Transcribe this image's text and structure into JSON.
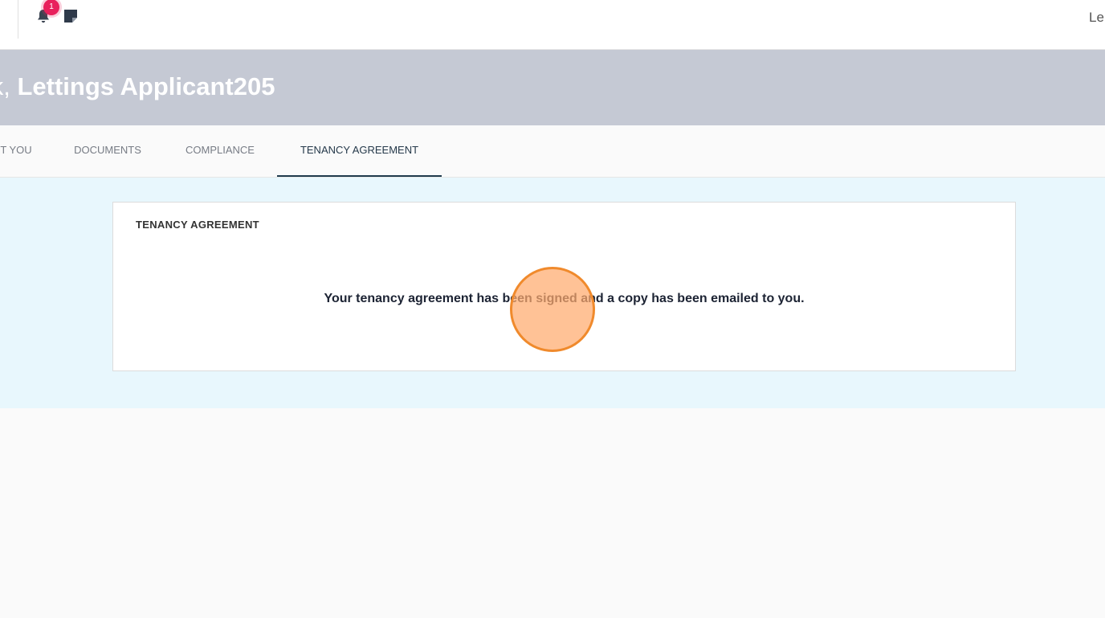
{
  "topbar": {
    "notification_count": "1",
    "user_name_partial": "Le"
  },
  "banner": {
    "greeting_prefix": "ack,",
    "user_name": "Lettings Applicant205"
  },
  "tabs": [
    {
      "label": "T YOU",
      "active": false
    },
    {
      "label": "DOCUMENTS",
      "active": false
    },
    {
      "label": "COMPLIANCE",
      "active": false
    },
    {
      "label": "TENANCY AGREEMENT",
      "active": true
    }
  ],
  "card": {
    "title": "TENANCY AGREEMENT",
    "message": "Your tenancy agreement has been signed and a copy has been emailed to you."
  },
  "colors": {
    "banner": "#c5c9d4",
    "content_bg": "#e8f7fd",
    "badge": "#e8205c",
    "active_tab": "#1f3b4d",
    "click_marker": "#f08a2c"
  },
  "icons": [
    "bell-icon",
    "sticky-note-icon"
  ]
}
